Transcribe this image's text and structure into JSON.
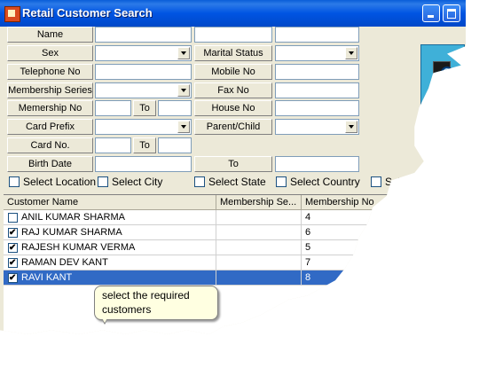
{
  "window": {
    "title": "Retail Customer Search"
  },
  "form": {
    "name_label": "Name",
    "sex_label": "Sex",
    "marital_status_label": "Marital Status",
    "telephone_label": "Telephone No",
    "mobile_label": "Mobile No",
    "membership_series_label": "Membership Series",
    "fax_label": "Fax No",
    "membership_no_label": "Memership No",
    "to_label_1": "To",
    "house_no_label": "House No",
    "card_prefix_label": "Card Prefix",
    "parent_child_label": "Parent/Child",
    "card_no_label": "Card No.",
    "to_label_2": "To",
    "birth_date_label": "Birth Date",
    "to_label_3": "To"
  },
  "filters": {
    "location": "Select Location",
    "city": "Select City",
    "state": "Select State",
    "country": "Select Country",
    "more": "Select"
  },
  "side_button": {
    "letter": "S"
  },
  "grid": {
    "headers": [
      "Customer Name",
      "Membership Se...",
      "Membership No"
    ],
    "rows": [
      {
        "name": "ANIL KUMAR SHARMA",
        "series": "",
        "number": "4",
        "checked": false
      },
      {
        "name": "RAJ KUMAR SHARMA",
        "series": "",
        "number": "6",
        "checked": true
      },
      {
        "name": "RAJESH KUMAR VERMA",
        "series": "",
        "number": "5",
        "checked": true
      },
      {
        "name": "RAMAN DEV KANT",
        "series": "",
        "number": "7",
        "checked": true
      },
      {
        "name": "RAVI KANT",
        "series": "",
        "number": "8",
        "checked": true
      }
    ],
    "selected_index": 4
  },
  "callout": {
    "text": "select the required customers"
  },
  "colors": {
    "titlebar": "#0054e3",
    "selection": "#316ac5",
    "window_bg": "#ece9d8",
    "tooltip_bg": "#ffffe1"
  }
}
